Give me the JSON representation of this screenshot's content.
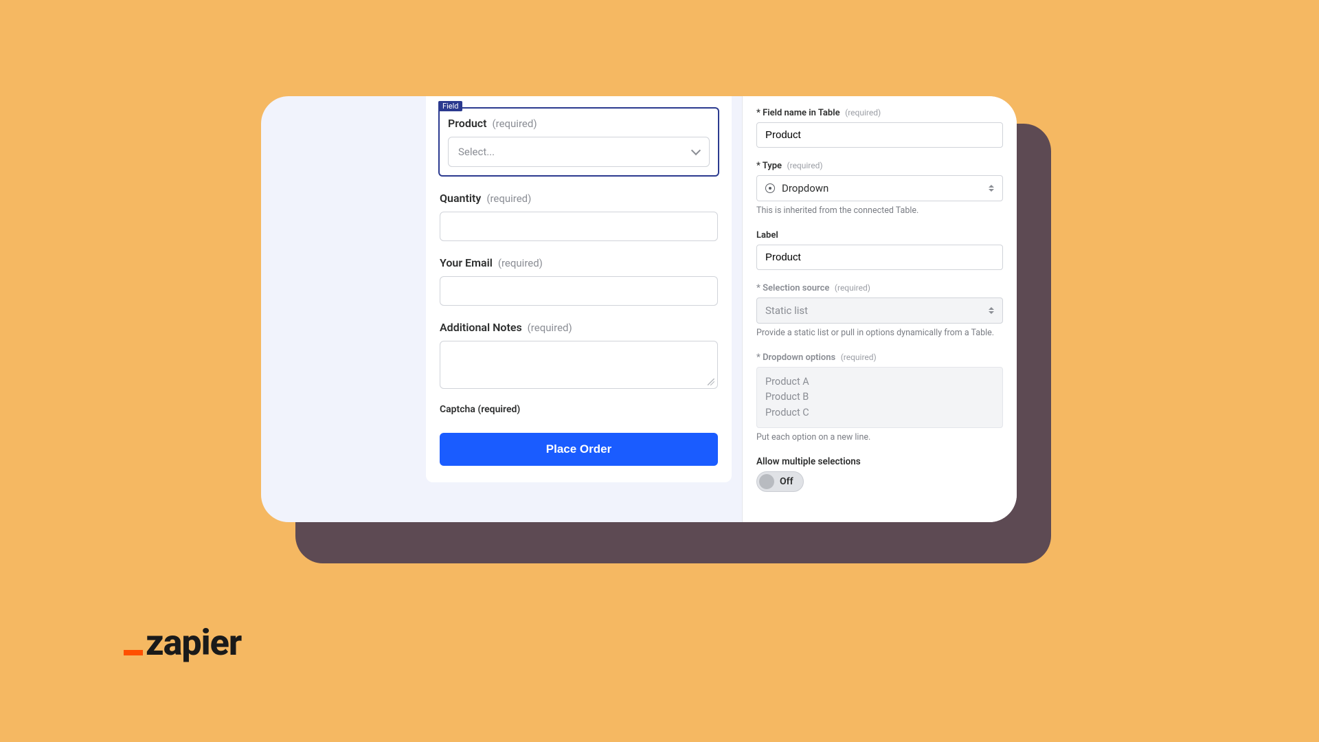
{
  "brand": {
    "name": "zapier"
  },
  "form": {
    "field_tag": "Field",
    "product": {
      "label": "Product",
      "required_text": "(required)",
      "placeholder": "Select..."
    },
    "quantity": {
      "label": "Quantity",
      "required_text": "(required)"
    },
    "email": {
      "label": "Your Email",
      "required_text": "(required)"
    },
    "notes": {
      "label": "Additional Notes",
      "required_text": "(required)"
    },
    "captcha_text": "Captcha (required)",
    "submit_label": "Place Order"
  },
  "inspector": {
    "field_name": {
      "label": "Field name in Table",
      "required_text": "(required)",
      "value": "Product"
    },
    "type": {
      "label": "Type",
      "required_text": "(required)",
      "value": "Dropdown",
      "helper": "This is inherited from the connected Table."
    },
    "display_label": {
      "label": "Label",
      "value": "Product"
    },
    "selection_source": {
      "label": "Selection source",
      "required_text": "(required)",
      "value": "Static list",
      "helper": "Provide a static list or pull in options dynamically from a Table."
    },
    "dropdown_options": {
      "label": "Dropdown options",
      "required_text": "(required)",
      "options": [
        "Product A",
        "Product B",
        "Product C"
      ],
      "helper": "Put each option on a new line."
    },
    "allow_multi": {
      "label": "Allow multiple selections",
      "state_text": "Off",
      "value": false
    }
  }
}
